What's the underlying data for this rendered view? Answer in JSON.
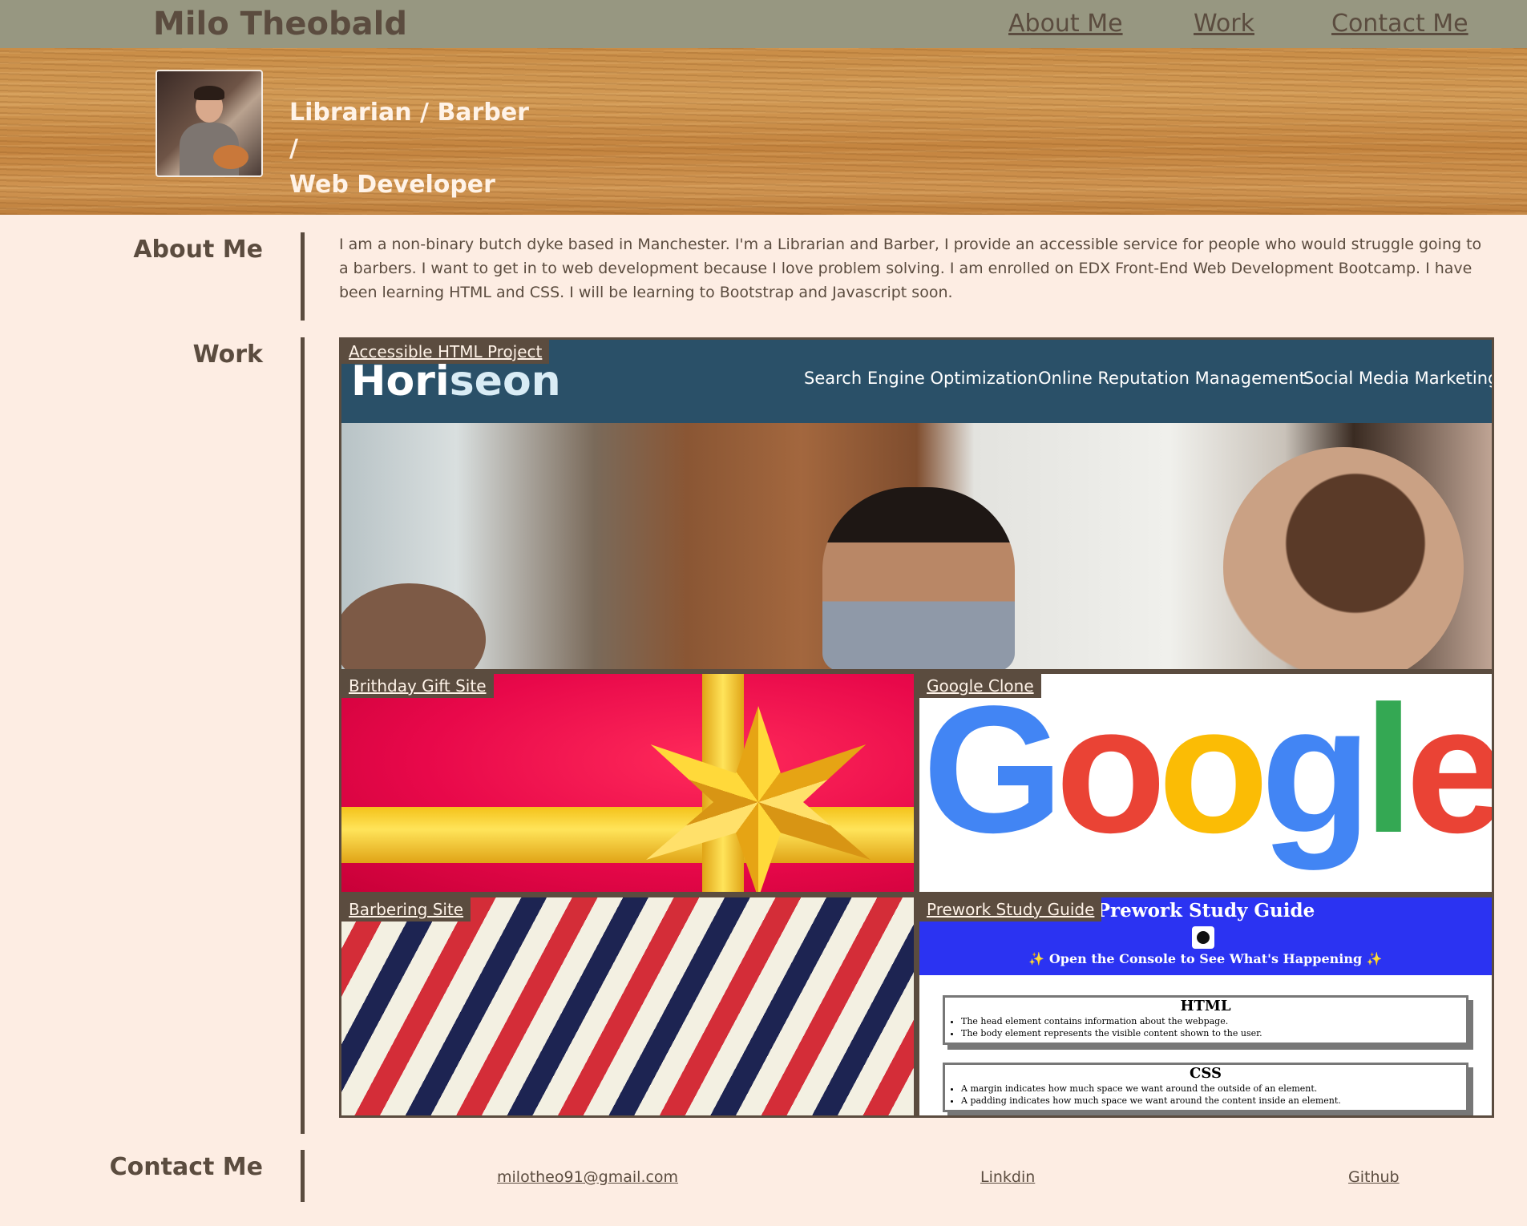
{
  "header": {
    "name": "Milo Theobald",
    "nav": [
      {
        "label": "About Me"
      },
      {
        "label": "Work"
      },
      {
        "label": "Contact Me"
      }
    ]
  },
  "hero": {
    "tagline_line1": "Librarian / Barber /",
    "tagline_line2": "Web Developer"
  },
  "about": {
    "heading": "About Me",
    "text": "I am a non-binary butch dyke based in Manchester. I'm a Librarian and Barber, I provide an accessible service for people who would struggle going to a barbers. I want to get in to web development because I love problem solving. I am enrolled on EDX Front-End Web Development Bootcamp. I have been learning HTML and CSS. I will be learning to Bootstrap and Javascript soon."
  },
  "work": {
    "heading": "Work",
    "projects": [
      {
        "label": "Accessible HTML Project",
        "preview": {
          "logo_a": "Hori",
          "logo_b": "seon",
          "nav": [
            "Search Engine Optimization",
            "Online Reputation Management",
            "Social Media Marketing"
          ]
        }
      },
      {
        "label": "Brithday Gift Site"
      },
      {
        "label": "Google Clone",
        "preview": {
          "letters": [
            "G",
            "o",
            "o",
            "g",
            "l",
            "e"
          ]
        }
      },
      {
        "label": "Barbering Site"
      },
      {
        "label": "Prework Study Guide",
        "preview": {
          "title": "Prework Study Guide",
          "subtitle": "✨ Open the Console to See What's Happening ✨",
          "boxes": [
            {
              "title": "HTML",
              "items": [
                "The head element contains information about the webpage.",
                "The body element represents the visible content shown to the user."
              ]
            },
            {
              "title": "CSS",
              "items": [
                "A margin indicates how much space we want around the outside of an element.",
                "A padding indicates how much space we want around the content inside an element."
              ]
            }
          ]
        }
      }
    ]
  },
  "contact": {
    "heading": "Contact Me",
    "links": [
      {
        "label": "milotheo91@gmail.com"
      },
      {
        "label": "Linkdin"
      },
      {
        "label": "Github"
      }
    ]
  },
  "colors": {
    "page_bg": "#fdede3",
    "topbar": "#979781",
    "text": "#5b4c3f",
    "horiseon_header": "#2a5068",
    "prework_header": "#2b33f2"
  }
}
